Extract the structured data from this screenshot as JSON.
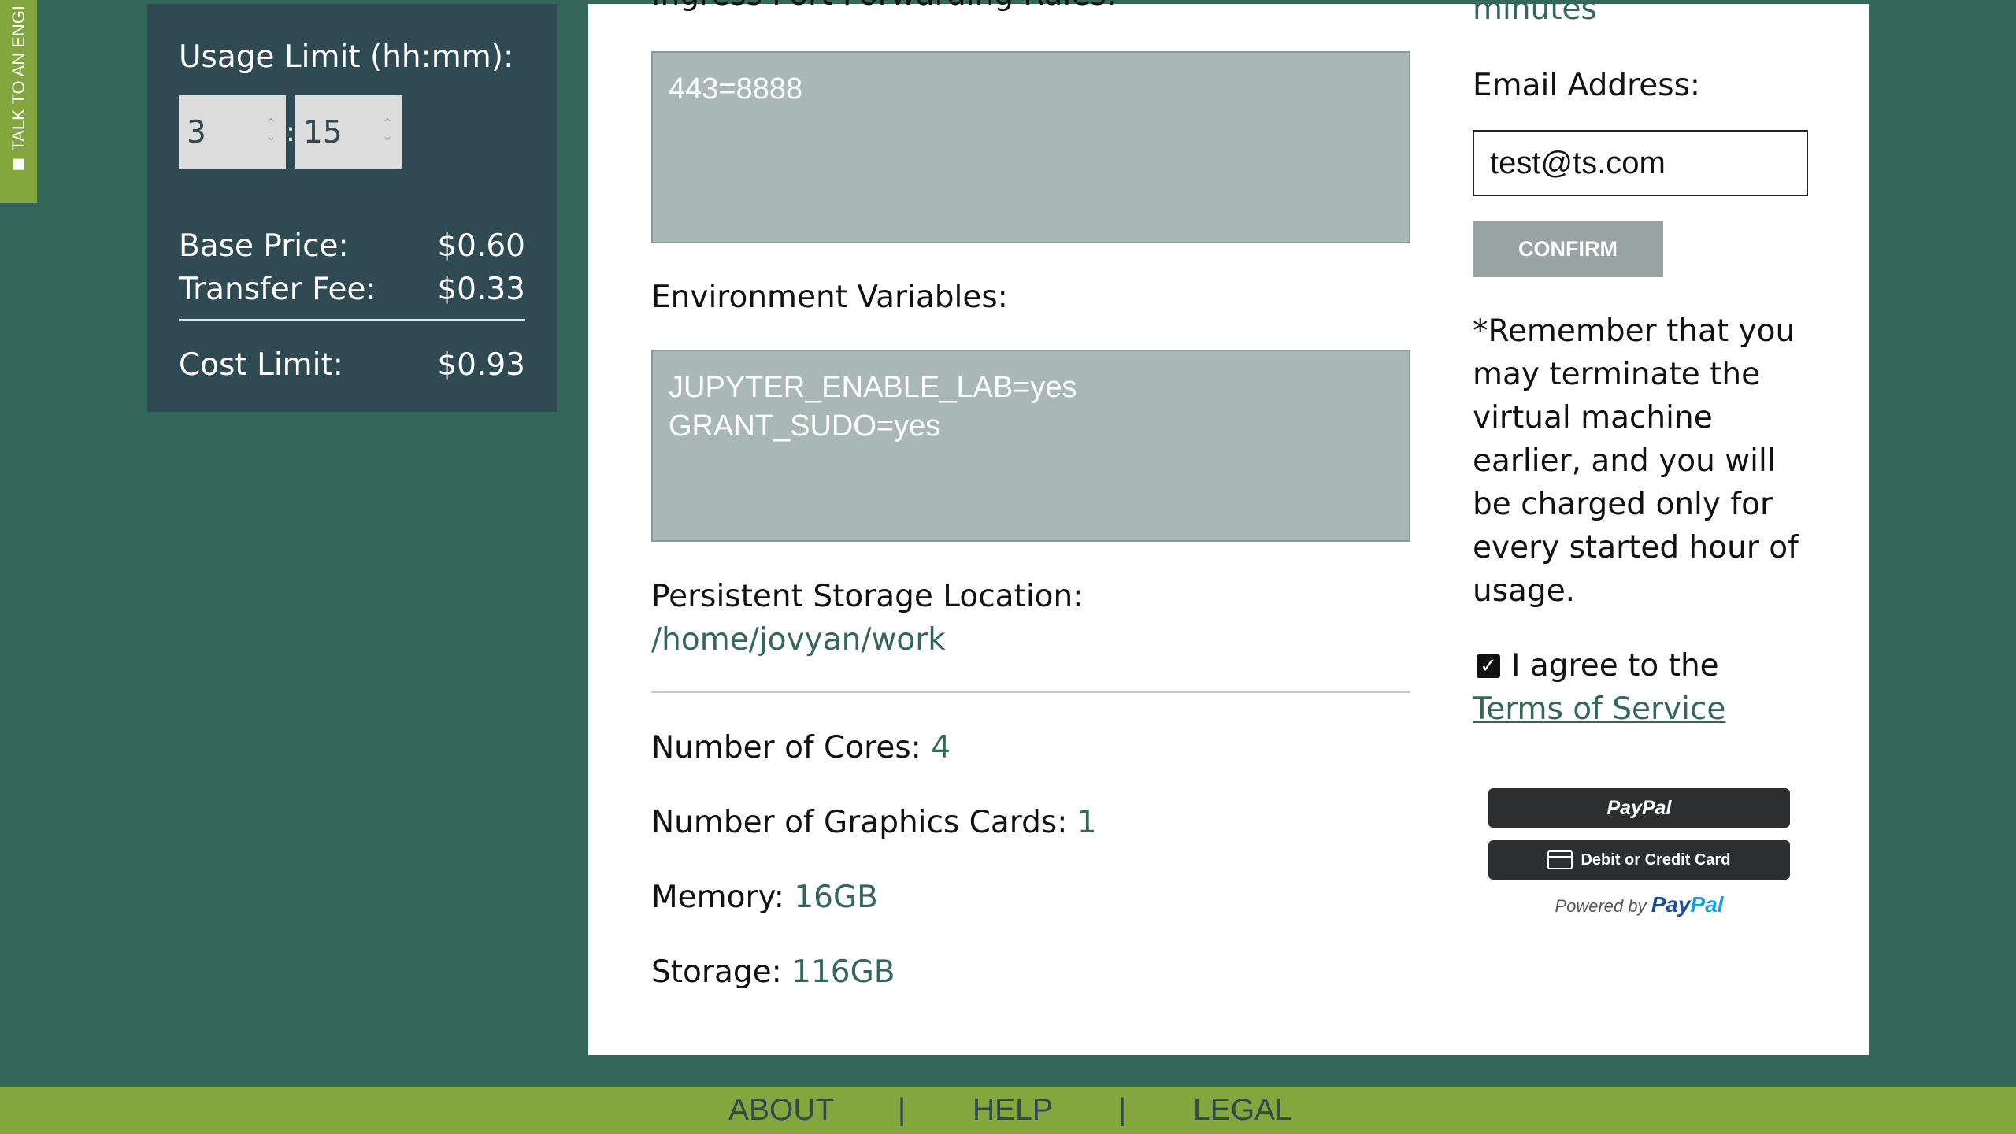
{
  "side_tab": {
    "label": "TALK TO AN ENGI"
  },
  "pricing": {
    "usage_label": "Usage Limit (hh:mm):",
    "hours": "3",
    "minutes": "15",
    "time_separator": ":",
    "base_price_label": "Base Price:",
    "base_price_value": "$0.60",
    "transfer_fee_label": "Transfer Fee:",
    "transfer_fee_value": "$0.33",
    "cost_limit_label": "Cost Limit:",
    "cost_limit_value": "$0.93"
  },
  "config": {
    "ingress_label": "Ingress Port Forwarding Rules:",
    "ingress_value": "443=8888",
    "env_label": "Environment Variables:",
    "env_value": "JUPYTER_ENABLE_LAB=yes\nGRANT_SUDO=yes",
    "storage_location_label": "Persistent Storage Location:",
    "storage_location_value": "/home/jovyan/work",
    "cores_label": "Number of Cores:",
    "cores_value": "4",
    "gpus_label": "Number of Graphics Cards:",
    "gpus_value": "1",
    "memory_label": "Memory:",
    "memory_value": "16GB",
    "storage_label": "Storage:",
    "storage_value": "116GB"
  },
  "checkout": {
    "minutes_text": "minutes",
    "email_label": "Email Address:",
    "email_value": "test@ts.com",
    "confirm_label": "CONFIRM",
    "remember_note": "*Remember that you may terminate the virtual machine earlier, and you will be charged only for every started hour of usage.",
    "agree_text": "I agree to the",
    "tos_link": "Terms of Service",
    "paypal_label": "PayPal",
    "card_label": "Debit or Credit Card",
    "powered_by": "Powered by",
    "powered_brand_pay": "Pay",
    "powered_brand_pal": "Pal"
  },
  "footer": {
    "about": "ABOUT",
    "sep1": "|",
    "help": "HELP",
    "sep2": "|",
    "legal": "LEGAL"
  },
  "colors": {
    "background": "#33675a",
    "card": "#2f4a52",
    "accent_green": "#84a63f",
    "textarea": "#a9b8b6"
  }
}
